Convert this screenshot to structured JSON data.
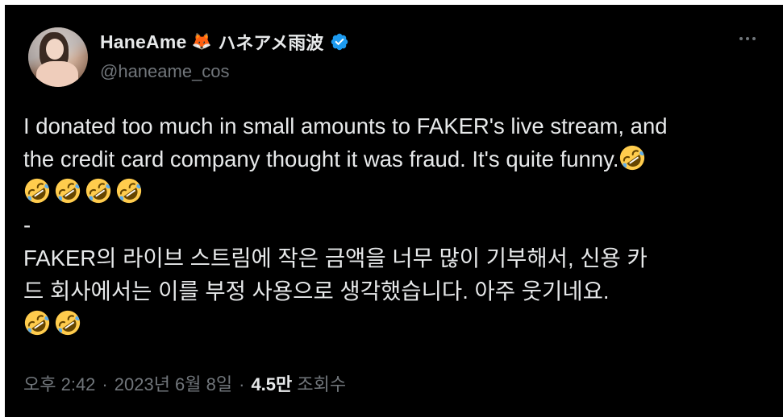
{
  "author": {
    "display_name": "HaneAme",
    "emoji": "🦊",
    "kana_name": "ハネアメ雨波",
    "handle": "@haneame_cos",
    "verified_icon": "verified-badge-icon",
    "avatar_icon": "avatar-photo"
  },
  "more_icon": "more-options-icon",
  "tweet": {
    "en_line1": "I donated too much in small amounts to FAKER's live stream, and",
    "en_line2": "the credit card company thought it was fraud. It's quite funny.",
    "separator": "-",
    "ko_line1": "FAKER의 라이브 스트림에 작은 금액을 너무 많이 기부해서, 신용 카",
    "ko_line2": "드 회사에서는 이를 부정 사용으로 생각했습니다. 아주 웃기네요.",
    "emoji_name": "rolling-on-floor-laughing-emoji"
  },
  "meta": {
    "time": "오후 2:42",
    "dot1": "·",
    "date": "2023년 6월 8일",
    "dot2": "·",
    "views_count": "4.5만",
    "views_label": "조회수"
  },
  "colors": {
    "background": "#000000",
    "text": "#e7e9ea",
    "secondary": "#71767b",
    "verified": "#1d9bf0"
  }
}
